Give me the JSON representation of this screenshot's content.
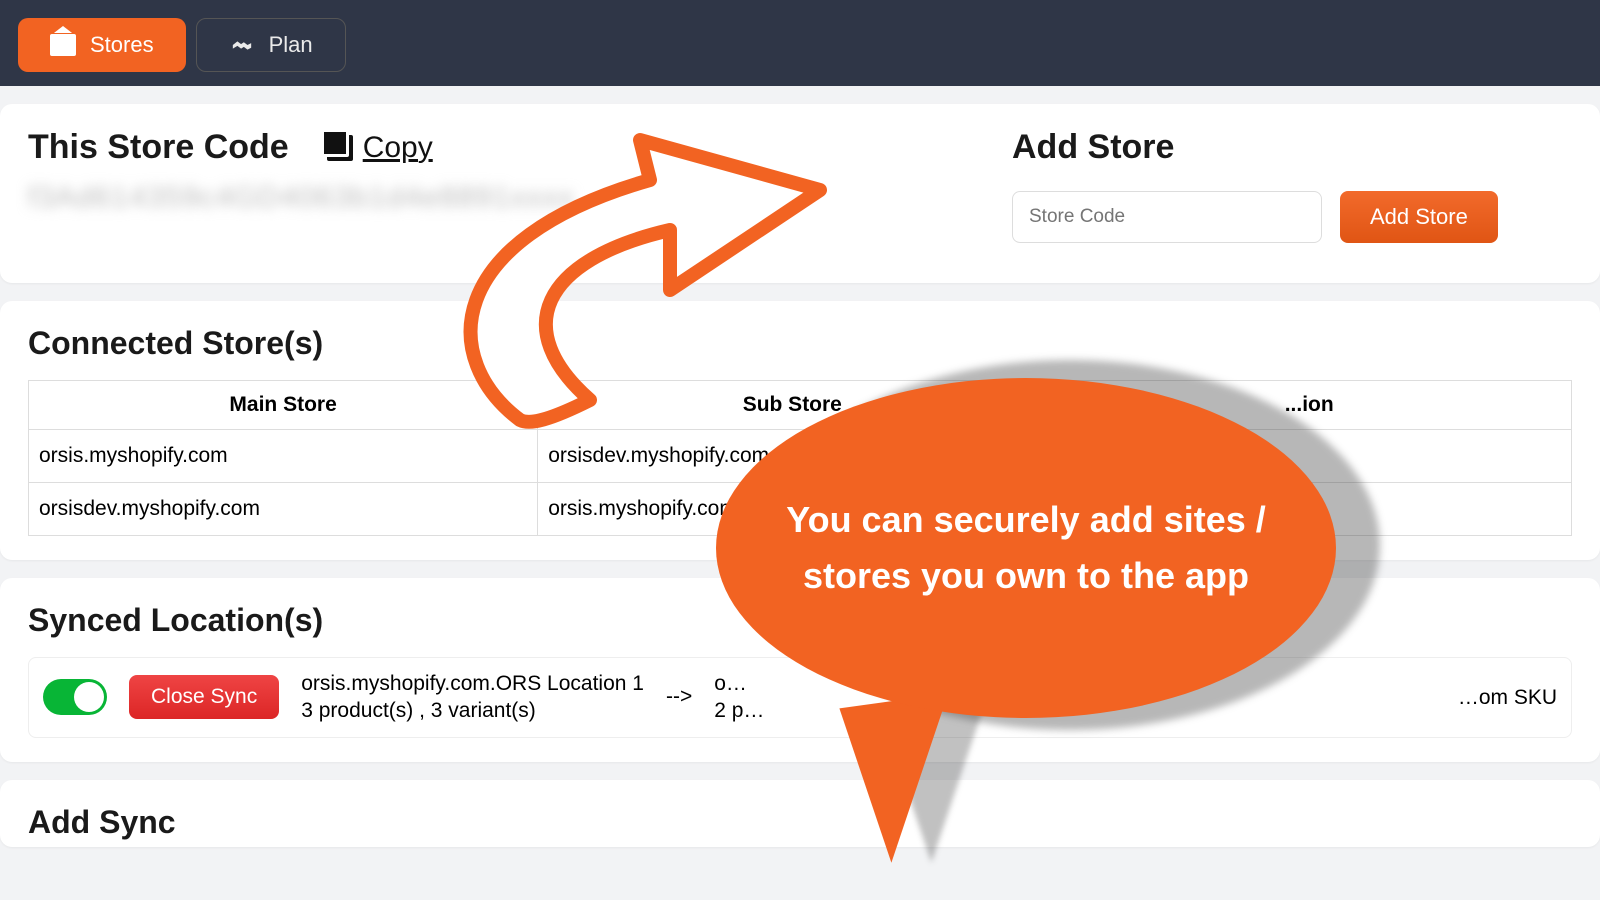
{
  "nav": {
    "tabs": [
      {
        "label": "Stores",
        "active": true
      },
      {
        "label": "Plan",
        "active": false
      }
    ]
  },
  "store_code": {
    "title": "This Store Code",
    "copy_label": "Copy",
    "blurred_value": "f3Ad614359c4GD4063b1d4e8891xxxx"
  },
  "add_store": {
    "title": "Add Store",
    "input_placeholder": "Store Code",
    "button_label": "Add Store"
  },
  "connected": {
    "title": "Connected Store(s)",
    "columns": [
      "Main Store",
      "Sub Store",
      "...ion"
    ],
    "rows": [
      {
        "main": "orsis.myshopify.com",
        "sub": "orsisdev.myshopify.com",
        "extra": ""
      },
      {
        "main": "orsisdev.myshopify.com",
        "sub": "orsis.myshopify.com",
        "extra": ""
      }
    ]
  },
  "synced": {
    "title": "Synced Location(s)",
    "toggle_on": true,
    "close_label": "Close Sync",
    "left_line1": "orsis.myshopify.com.ORS Location 1",
    "left_line2": "3 product(s) , 3 variant(s)",
    "arrow": "-->",
    "right_line1": "o…",
    "right_line2": "2 p…",
    "right_suffix": "…om SKU"
  },
  "add_sync": {
    "title": "Add Sync"
  },
  "callout": {
    "text": "You can securely add sites / stores you own to the app"
  }
}
